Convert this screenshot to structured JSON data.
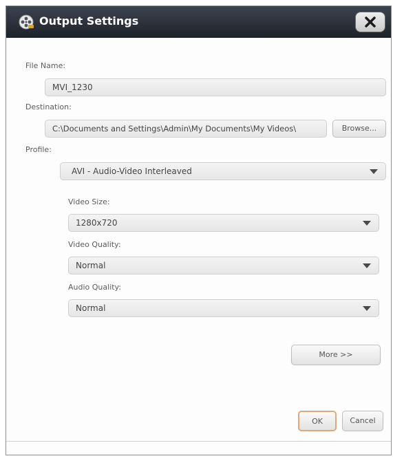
{
  "window": {
    "title": "Output Settings",
    "close_label": "X"
  },
  "file_name": {
    "label": "File Name:",
    "value": "MVI_1230"
  },
  "destination": {
    "label": "Destination:",
    "value": "C:\\Documents and Settings\\Admin\\My Documents\\My Videos\\",
    "browse_label": "Browse..."
  },
  "profile": {
    "label": "Profile:",
    "value": "AVI - Audio-Video Interleaved"
  },
  "video_size": {
    "label": "Video Size:",
    "value": "1280x720"
  },
  "video_quality": {
    "label": "Video Quality:",
    "value": "Normal"
  },
  "audio_quality": {
    "label": "Audio Quality:",
    "value": "Normal"
  },
  "buttons": {
    "more": "More >>",
    "ok": "OK",
    "cancel": "Cancel"
  }
}
